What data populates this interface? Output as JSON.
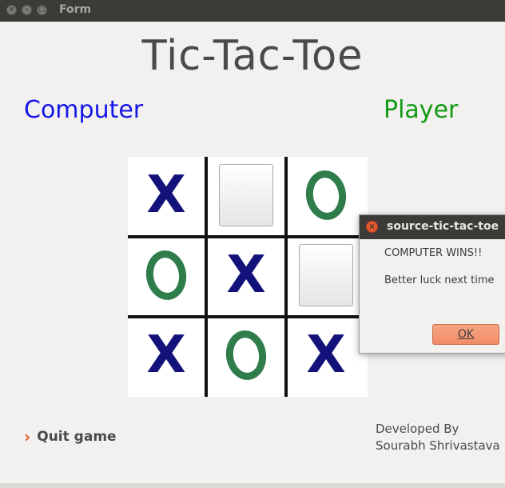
{
  "window": {
    "title": "Form",
    "close_glyph": "×",
    "minimize_glyph": "–",
    "maximize_glyph": "□"
  },
  "game": {
    "title": "Tic-Tac-Toe",
    "left_player": "Computer",
    "right_player": "Player",
    "board": [
      [
        "X",
        "",
        "O"
      ],
      [
        "O",
        "X",
        ""
      ],
      [
        "X",
        "O",
        "X"
      ]
    ]
  },
  "footer": {
    "quit_icon": "chevron-right-icon",
    "quit_arrow": "›",
    "quit_label": "Quit game",
    "developed_by": "Developed By",
    "developer_name": "Sourabh Shrivastava"
  },
  "dialog": {
    "title": "source-tic-tac-toe",
    "close_glyph": "×",
    "message_1": "COMPUTER WINS!!",
    "message_2": "Better luck next time",
    "ok_label": "OK"
  },
  "colors": {
    "computer": "#1515e8",
    "player": "#129a12",
    "x_mark": "#12127a",
    "o_mark": "#2e7d4a",
    "ok_button": "#f08c66"
  }
}
